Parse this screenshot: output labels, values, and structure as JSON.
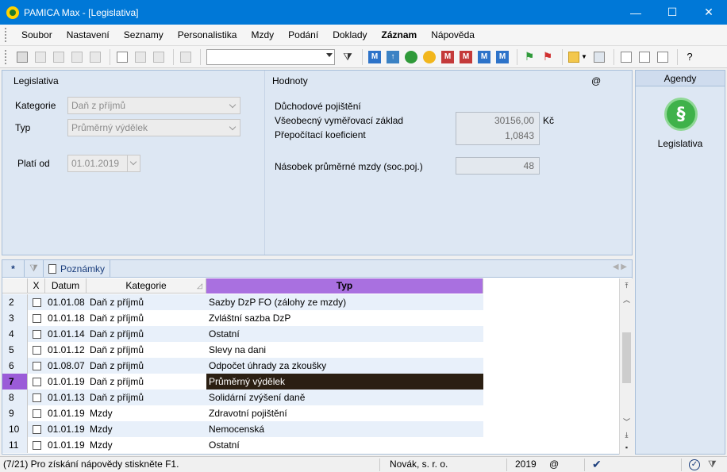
{
  "window": {
    "title": "PAMICA Max - [Legislativa]",
    "minimize": "—",
    "maximize": "☐",
    "close": "✕"
  },
  "menu": [
    "Soubor",
    "Nastavení",
    "Seznamy",
    "Personalistika",
    "Mzdy",
    "Podání",
    "Doklady",
    "Záznam",
    "Nápověda"
  ],
  "toolbar": {
    "search_value": "",
    "m_buttons": [
      "M",
      "M",
      "M",
      "M",
      "M",
      "M"
    ]
  },
  "detail": {
    "left_title": "Legislativa",
    "right_title": "Hodnoty",
    "at_symbol": "@",
    "kategorie_label": "Kategorie",
    "kategorie_value": "Daň z příjmů",
    "typ_label": "Typ",
    "typ_value": "Průměrný výdělek",
    "plati_od_label": "Platí od",
    "plati_od_value": "01.01.2019",
    "section_heading": "Důchodové pojištění",
    "vz_label": "Všeobecný vyměřovací základ",
    "vz_value": "30156,00",
    "vz_unit": "Kč",
    "pk_label": "Přepočítací koeficient",
    "pk_value": "1,0843",
    "nasobek_label": "Násobek průměrné mzdy (soc.poj.)",
    "nasobek_value": "48"
  },
  "grid": {
    "tabs": {
      "star": "*",
      "notes": "Poznámky"
    },
    "headers": {
      "x": "X",
      "datum": "Datum",
      "kategorie": "Kategorie",
      "typ": "Typ"
    },
    "rows": [
      {
        "num": "2",
        "date": "01.01.08",
        "cat": "Daň z příjmů",
        "typ": "Sazby DzP FO (zálohy ze mzdy)"
      },
      {
        "num": "3",
        "date": "01.01.18",
        "cat": "Daň z příjmů",
        "typ": "Zvláštní sazba DzP"
      },
      {
        "num": "4",
        "date": "01.01.14",
        "cat": "Daň z příjmů",
        "typ": "Ostatní"
      },
      {
        "num": "5",
        "date": "01.01.12",
        "cat": "Daň z příjmů",
        "typ": "Slevy na dani"
      },
      {
        "num": "6",
        "date": "01.08.07",
        "cat": "Daň z příjmů",
        "typ": "Odpočet úhrady za zkoušky"
      },
      {
        "num": "7",
        "date": "01.01.19",
        "cat": "Daň z příjmů",
        "typ": "Průměrný výdělek"
      },
      {
        "num": "8",
        "date": "01.01.13",
        "cat": "Daň z příjmů",
        "typ": "Solidární zvýšení daně"
      },
      {
        "num": "9",
        "date": "01.01.19",
        "cat": "Mzdy",
        "typ": "Zdravotní pojištění"
      },
      {
        "num": "10",
        "date": "01.01.19",
        "cat": "Mzdy",
        "typ": "Nemocenská"
      },
      {
        "num": "11",
        "date": "01.01.19",
        "cat": "Mzdy",
        "typ": "Ostatní"
      }
    ]
  },
  "agenda": {
    "title": "Agendy",
    "item_label": "Legislativa",
    "item_symbol": "§"
  },
  "status": {
    "help": "(7/21) Pro získání nápovědy stiskněte F1.",
    "company": "Novák, s. r. o.",
    "year": "2019",
    "at": "@"
  },
  "colors": {
    "titlebar": "#0078d7",
    "selected_row_num": "#9b5bd8",
    "selected_cell": "#2b1f12",
    "typ_header": "#a970e0"
  }
}
